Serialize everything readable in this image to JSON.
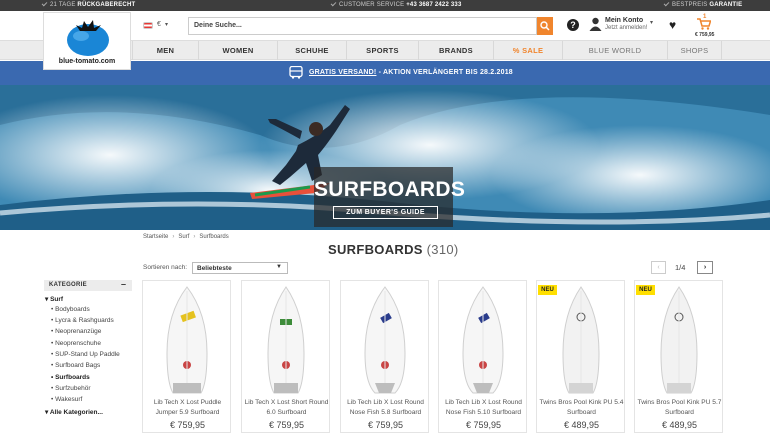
{
  "topbar": {
    "left_pre": "21 TAGE",
    "left_bold": "RÜCKGABERECHT",
    "center_pre": "CUSTOMER SERVICE",
    "center_bold": "+43 3687 2422 333",
    "right_pre": "BESTPREIS",
    "right_bold": "GARANTIE"
  },
  "header": {
    "logo_text": "blue-tomato.com",
    "currency": "€",
    "search_placeholder": "Deine Suche...",
    "help": "?",
    "account_title": "Mein Konto",
    "account_sub": "Jetzt anmelden!",
    "cart_count": "1",
    "cart_total": "€ 759,95"
  },
  "nav": {
    "items": [
      "MEN",
      "WOMEN",
      "SCHUHE",
      "SPORTS",
      "BRANDS",
      "% SALE",
      "BLUE WORLD",
      "SHOPS"
    ]
  },
  "promo": {
    "highlight": "GRATIS VERSAND!",
    "text": " - AKTION VERLÄNGERT BIS 28.2.2018"
  },
  "hero": {
    "title": "SURFBOARDS",
    "button": "ZUM BUYER'S GUIDE"
  },
  "breadcrumb": [
    "Startseite",
    "Surf",
    "Surfboards"
  ],
  "listing": {
    "title": "SURFBOARDS",
    "count": "(310)",
    "sort_label": "Sortieren nach:",
    "sort_value": "Beliebteste",
    "page": "1/4",
    "prev": "‹",
    "next": "›"
  },
  "sidebar": {
    "heading": "KATEGORIE",
    "collapse": "–",
    "parent": "Surf",
    "items": [
      "Bodyboards",
      "Lycra & Rashguards",
      "Neoprenanzüge",
      "Neoprenschuhe",
      "SUP-Stand Up Paddle",
      "Surfboard Bags",
      "Surfboards",
      "Surfzubehör",
      "Wakesurf"
    ],
    "all": "Alle Kategorien..."
  },
  "products": [
    {
      "name": "Lib Tech X Lost Puddle Jumper 5.9 Surfboard",
      "price": "€ 759,95",
      "badge": ""
    },
    {
      "name": "Lib Tech X Lost Short Round 6.0 Surfboard",
      "price": "€ 759,95",
      "badge": ""
    },
    {
      "name": "Lib Tech Lib X Lost Round Nose Fish 5.8 Surfboard",
      "price": "€ 759,95",
      "badge": ""
    },
    {
      "name": "Lib Tech Lib X Lost Round Nose Fish 5.10 Surfboard",
      "price": "€ 759,95",
      "badge": ""
    },
    {
      "name": "Twins Bros Pool Kink PU 5.4 Surfboard",
      "price": "€ 489,95",
      "badge": "NEU"
    },
    {
      "name": "Twins Bros Pool Kink PU 5.7 Surfboard",
      "price": "€ 489,95",
      "badge": "NEU"
    }
  ],
  "colors": {
    "accent": "#f0852d",
    "promo": "#3a69b0",
    "badge": "#ffdf00"
  }
}
